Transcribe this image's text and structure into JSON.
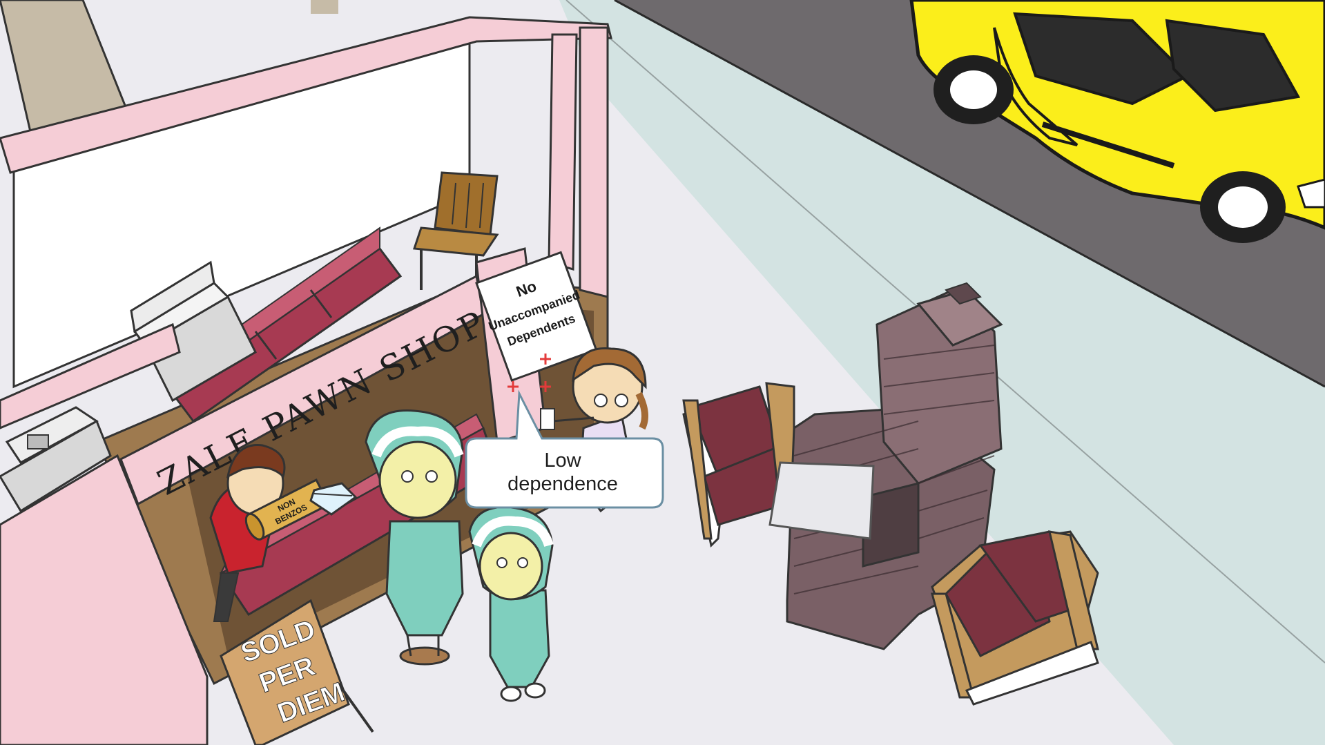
{
  "scene": {
    "shop_sign": "ZALE PAWN SHOP",
    "door_sign": {
      "line1": "No",
      "line2": "Unaccompanied",
      "line3": "Dependents"
    },
    "speech_bubble": {
      "line1": "Low",
      "line2": "dependence"
    },
    "scroll_label": {
      "line1": "NON",
      "line2": "BENZOS"
    },
    "sandwich_board": {
      "line1": "SOLD",
      "line2": "PER",
      "line3": "DIEM"
    }
  },
  "colors": {
    "shop_wall_pink": "#f5cdd6",
    "counter_red": "#a73a52",
    "sidewalk": "#ecebf0",
    "road": "#6e6a6d",
    "curb_band": "#d3e3e2",
    "taxi_yellow": "#fbee1b",
    "chair_cushion": "#7c3340",
    "bricks": "#7a6066",
    "teal_suit": "#7fcfbe"
  }
}
